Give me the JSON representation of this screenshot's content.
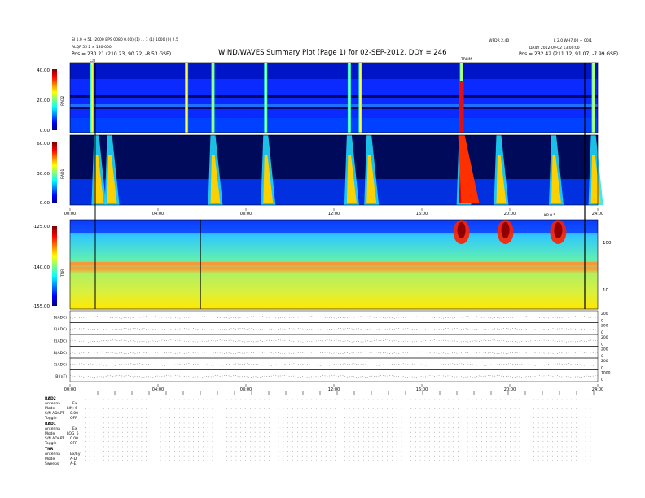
{
  "header": {
    "title": "WIND/WAVES Summary Plot (Page 1) for 02-SEP-2012, DOY = 246",
    "top_left_line1": "SI 1.0 + 51 (2000 BPS 0080 0.00) (1) ... 1 (1) 1000 (0) 2.5",
    "top_left_line2": "ALQP 55 2 ± 130-000",
    "top_left_line3": "Pos = 230.21 (210.23, 90.72, -8.53 GSE)",
    "top_center_right": "WPDR 2.40",
    "top_right_line1": "L 2.0 WH7.00 + 00/1",
    "top_right_line2": "DAILY 2012-09-02 13:00:00",
    "top_right_line3": "Pos = 232.42 (211.12, 91.07, -7.99 GSE)",
    "marker_left": "Cal",
    "marker_center": "TRLIM",
    "marker_right": "KP 0.5"
  },
  "time_axis": {
    "ticks": [
      "00:00",
      "04:00",
      "08:00",
      "12:00",
      "16:00",
      "20:00",
      "24:00"
    ]
  },
  "rad2": {
    "label": "RAD2",
    "ticks": [
      "40.00",
      "20.00",
      "0.00"
    ]
  },
  "rad1": {
    "label": "RAD1",
    "ticks": [
      "60.00",
      "30.00",
      "0.00"
    ]
  },
  "tnr": {
    "label": "TNR",
    "ticks": [
      "-125.00",
      "-140.00",
      "-155.00"
    ],
    "right_ticks": [
      "100",
      "10"
    ]
  },
  "line_panels": [
    {
      "label": "B(ADC)",
      "right_ticks": [
        "200",
        "0"
      ]
    },
    {
      "label": "E(ADC)",
      "right_ticks": [
        "200",
        "0"
      ]
    },
    {
      "label": "E(ADC)",
      "right_ticks": [
        "200",
        "0"
      ]
    },
    {
      "label": "B(ADC)",
      "right_ticks": [
        "200",
        "0"
      ]
    },
    {
      "label": "X(ADC)",
      "right_ticks": [
        "200",
        "0"
      ]
    },
    {
      "label": "|B|(nT)",
      "right_ticks": [
        "1000",
        "0"
      ]
    }
  ],
  "status_block": {
    "rad2": {
      "title": "RAD2",
      "rows": [
        {
          "key": "Antenna",
          "value": "Ex"
        },
        {
          "key": "Mode",
          "value": "LIN: 6"
        },
        {
          "key": "S/N ADAPT",
          "value": "0.00"
        },
        {
          "key": "Toggle",
          "value": "OFF"
        }
      ]
    },
    "rad1": {
      "title": "RAD1",
      "rows": [
        {
          "key": "Antenna",
          "value": "Ex"
        },
        {
          "key": "Mode",
          "value": "LOG_6"
        },
        {
          "key": "S/N ADAPT",
          "value": "0.00"
        },
        {
          "key": "Toggle",
          "value": "OFF"
        }
      ]
    },
    "tnr": {
      "title": "TNR",
      "rows": [
        {
          "key": "Antenna",
          "value": "Ex/Ey"
        },
        {
          "key": "Mode",
          "value": "A-D"
        },
        {
          "key": "Sweeps",
          "value": "A-E"
        }
      ]
    }
  },
  "chart_data": [
    {
      "type": "heatmap",
      "name_on_chart": "RAD2",
      "x": [
        "00:00",
        "04:00",
        "08:00",
        "12:00",
        "16:00",
        "20:00",
        "24:00"
      ],
      "ylim": [
        0,
        40
      ],
      "colorbar_range": [
        0,
        40
      ],
      "events_hours": [
        1.0,
        5.3,
        6.5,
        8.9,
        12.7,
        13.2,
        17.8,
        23.8
      ],
      "background_level": 0.2
    },
    {
      "type": "heatmap",
      "name_on_chart": "RAD1",
      "x": [
        "00:00",
        "04:00",
        "08:00",
        "12:00",
        "16:00",
        "20:00",
        "24:00"
      ],
      "ylim": [
        0,
        60
      ],
      "colorbar_range": [
        0,
        60
      ],
      "events_hours": [
        1.2,
        1.8,
        6.5,
        8.9,
        12.7,
        13.6,
        17.8,
        19.5,
        22.0,
        23.8
      ]
    },
    {
      "type": "heatmap",
      "name_on_chart": "TNR",
      "x": [
        "00:00",
        "04:00",
        "08:00",
        "12:00",
        "16:00",
        "20:00",
        "24:00"
      ],
      "ylim": [
        -155,
        -125
      ],
      "colorbar_range": [
        -155,
        -125
      ],
      "events_hours": [
        17.8,
        19.8,
        22.2
      ]
    }
  ],
  "colors": {
    "background": "#ffffff",
    "axis": "#000000",
    "spectrum_low": "#00007f",
    "spectrum_high": "#7f0000"
  }
}
